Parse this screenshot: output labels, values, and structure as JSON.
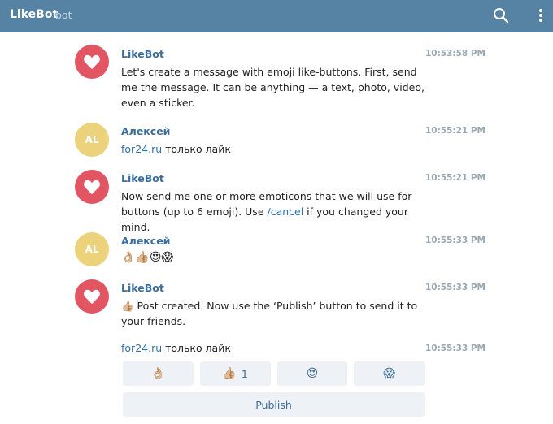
{
  "header": {
    "title": "LikeBot",
    "subtitle": "bot"
  },
  "messages": [
    {
      "avatar": "heart",
      "name": "LikeBot",
      "time": "10:53:58 PM",
      "text": "Let's create a message with emoji like-buttons. First, send me the message. It can be anything — a text, photo, video, even a sticker."
    },
    {
      "avatar_initials": "AL",
      "name": "Алексей",
      "time": "10:55:21 PM",
      "link": "for24.ru",
      "text_after": " только лайк"
    },
    {
      "avatar": "heart",
      "name": "LikeBot",
      "time": "10:55:21 PM",
      "text_before": "Now send me one or more emoticons that we will use for buttons (up to 6 emoji). Use ",
      "command": "/cancel",
      "text_after": " if you changed your mind."
    },
    {
      "avatar_initials": "AL",
      "name": "Алексей",
      "time": "10:55:33 PM",
      "emojis": "👌🏼👍🏼😍😱"
    },
    {
      "avatar": "heart",
      "name": "LikeBot",
      "time": "10:55:33 PM",
      "emoji": "👍🏼",
      "text": " Post created. Now use the ‘Publish’ button to send it to your friends."
    },
    {
      "time": "10:55:33 PM",
      "link": "for24.ru",
      "text_after": " только лайк"
    }
  ],
  "keyboard": {
    "buttons": [
      {
        "emoji": "👌🏼",
        "count": ""
      },
      {
        "emoji": "👍🏼",
        "count": "1"
      },
      {
        "emoji": "😍",
        "count": ""
      },
      {
        "emoji": "😱",
        "count": ""
      }
    ],
    "publish_label": "Publish"
  },
  "colors": {
    "header": "#5682a3",
    "bot_avatar": "#e25563",
    "user_avatar": "#ebd27b",
    "name": "#3a6d99",
    "link": "#2f6ea5"
  }
}
